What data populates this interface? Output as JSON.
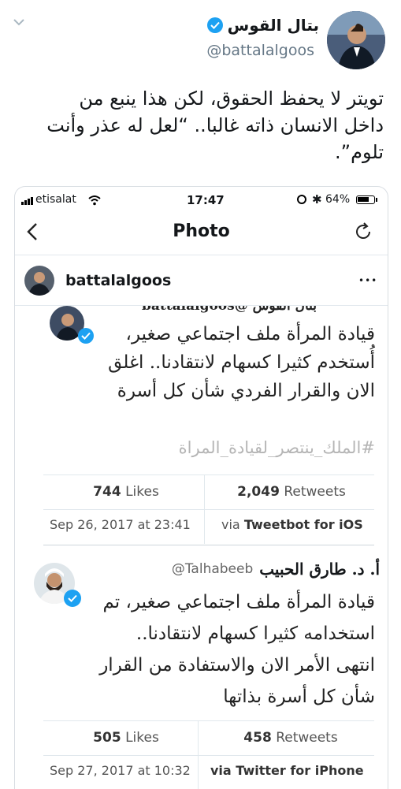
{
  "tweet": {
    "display_name": "بتال القوس",
    "handle": "@battalalgoos",
    "text_line1": "تويتر لا يحفظ الحقوق، لكن هذا ينبع من",
    "text_line2": "داخل الانسان ذاته غالبا.. “لعل له عذر وأنت",
    "text_line3": "تلوم”."
  },
  "phone": {
    "carrier": "etisalat",
    "time": "17:47",
    "battery": "64%",
    "nav_title": "Photo",
    "post_username": "battalalgoos",
    "more_label": "•••"
  },
  "embedded1": {
    "header_partial": "بتال القوس  @battalalgoos",
    "lines": [
      "قيادة المرأة ملف اجتماعي صغير،",
      "أُستخدم كثيرا كسهام لانتقادنا.. اغلق",
      "الان والقرار الفردي شأن كل أسرة"
    ],
    "hashtag": "#الملك_ينتصر_لقيادة_المراة",
    "likes_count": "744",
    "likes_label": "Likes",
    "retweets_count": "2,049",
    "retweets_label": "Retweets",
    "date": "Sep 26, 2017 at 23:41",
    "via_prefix": "via",
    "via_client": "Tweetbot for iOS"
  },
  "embedded2": {
    "name": "أ. د. طارق الحبيب",
    "handle": "@Talhabeeb",
    "lines": [
      "قيادة المرأة ملف اجتماعي صغير، تم",
      "استخدامه كثيرا كسهام لانتقادنا..",
      "انتهى الأمر الان والاستفادة من القرار",
      "شأن كل أسرة بذاتها"
    ],
    "likes_count": "505",
    "likes_label": "Likes",
    "retweets_count": "458",
    "retweets_label": "Retweets",
    "date_partial": "Sep 27, 2017 at 10:32",
    "via_partial": "via Twitter for iPhone"
  },
  "colors": {
    "verified_blue": "#1da1f2",
    "muted": "#657786",
    "border": "#e1e8ed"
  }
}
